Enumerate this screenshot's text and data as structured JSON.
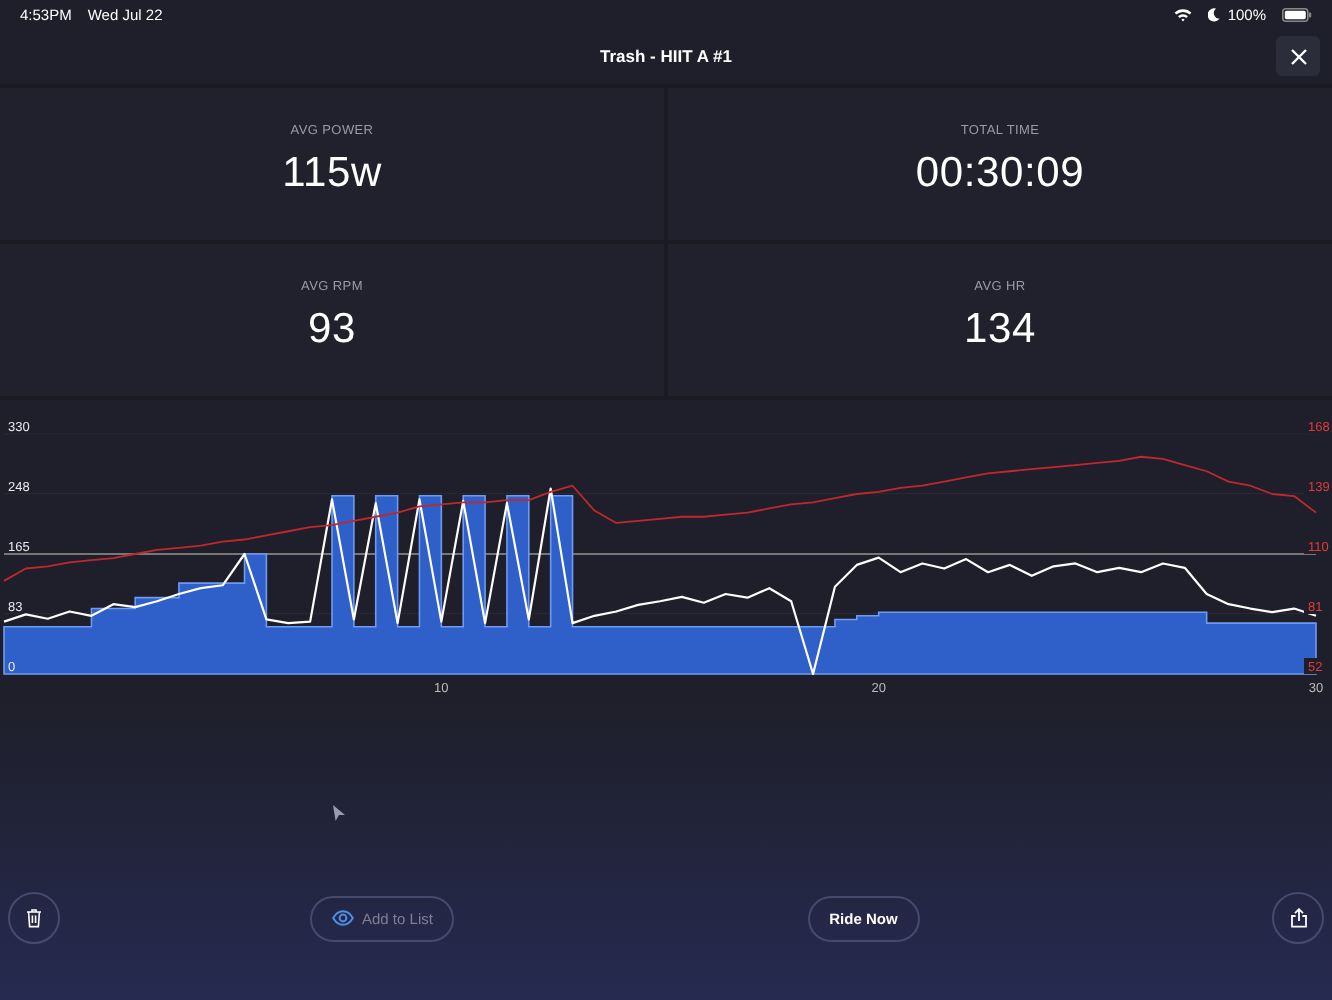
{
  "status_bar": {
    "time": "4:53PM",
    "date": "Wed Jul 22",
    "battery": "100%"
  },
  "window": {
    "title": "Trash - HIIT A #1"
  },
  "stats": [
    {
      "label": "AVG POWER",
      "value": "115w"
    },
    {
      "label": "TOTAL TIME",
      "value": "00:30:09"
    },
    {
      "label": "AVG RPM",
      "value": "93"
    },
    {
      "label": "AVG HR",
      "value": "134"
    }
  ],
  "chart": {
    "chart_data": {
      "type": "line",
      "xlim": [
        0,
        30
      ],
      "xticks": [
        10,
        20,
        30
      ],
      "ylim": [
        0,
        330
      ],
      "yticks": [
        0,
        83,
        165,
        248,
        330
      ],
      "y2lim": [
        52,
        168
      ],
      "y2ticks": [
        52,
        81,
        110,
        139,
        168
      ],
      "ref_lines": [
        {
          "axis": "y",
          "value": 165
        }
      ],
      "grid": true,
      "x": [
        0,
        0.5,
        1,
        1.5,
        2,
        2.5,
        3,
        3.5,
        4,
        4.5,
        5,
        5.5,
        6,
        6.5,
        7,
        7.5,
        8,
        8.5,
        9,
        9.5,
        10,
        10.5,
        11,
        11.5,
        12,
        12.5,
        13,
        13.5,
        14,
        14.5,
        15,
        15.5,
        16,
        16.5,
        17,
        17.5,
        18,
        18.5,
        19,
        19.5,
        20,
        20.5,
        21,
        21.5,
        22,
        22.5,
        23,
        23.5,
        24,
        24.5,
        25,
        25.5,
        26,
        26.5,
        27,
        27.5,
        28,
        28.5,
        29,
        29.5,
        30
      ],
      "series": [
        {
          "type": "area",
          "color": "#2f5fc8",
          "values": [
            65,
            65,
            65,
            65,
            90,
            90,
            105,
            105,
            125,
            125,
            125,
            165,
            65,
            65,
            65,
            245,
            65,
            245,
            65,
            245,
            65,
            245,
            65,
            245,
            65,
            245,
            65,
            65,
            65,
            65,
            65,
            65,
            65,
            65,
            65,
            65,
            65,
            65,
            75,
            80,
            85,
            85,
            85,
            85,
            85,
            85,
            85,
            85,
            85,
            85,
            85,
            85,
            85,
            85,
            85,
            70,
            70,
            70,
            70,
            70,
            70
          ]
        },
        {
          "color": "#ffffff",
          "values": [
            72,
            82,
            76,
            86,
            80,
            96,
            92,
            100,
            110,
            118,
            122,
            165,
            75,
            70,
            72,
            240,
            75,
            235,
            70,
            240,
            72,
            238,
            70,
            235,
            75,
            255,
            70,
            80,
            86,
            95,
            100,
            106,
            98,
            110,
            105,
            118,
            100,
            0,
            120,
            150,
            160,
            140,
            152,
            145,
            158,
            140,
            150,
            135,
            148,
            152,
            140,
            146,
            140,
            152,
            146,
            110,
            96,
            90,
            85,
            90,
            80
          ]
        },
        {
          "axis": "y2",
          "color": "#c0282d",
          "values": [
            97,
            103,
            104,
            106,
            107,
            108,
            110,
            112,
            113,
            114,
            116,
            117,
            119,
            121,
            123,
            124,
            126,
            128,
            130,
            133,
            134,
            135,
            135,
            136,
            136,
            140,
            143,
            131,
            125,
            126,
            127,
            128,
            128,
            129,
            130,
            132,
            134,
            135,
            137,
            139,
            140,
            142,
            143,
            145,
            147,
            149,
            150,
            151,
            152,
            153,
            154,
            155,
            157,
            156,
            153,
            150,
            145,
            143,
            139,
            138,
            130
          ]
        }
      ]
    }
  },
  "buttons": [
    {
      "label": "Add to List",
      "kind": "with_icon",
      "disabled": true
    },
    {
      "label": "Ride Now",
      "kind": "text",
      "disabled": false
    }
  ]
}
